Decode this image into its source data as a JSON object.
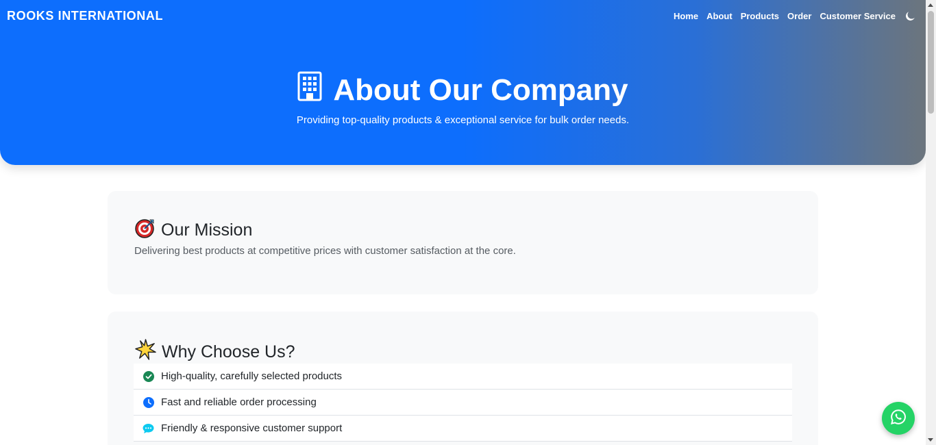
{
  "navbar": {
    "brand": "ROOKS INTERNATIONAL",
    "links": [
      "Home",
      "About",
      "Products",
      "Order",
      "Customer Service"
    ],
    "theme_icon": "moon-icon"
  },
  "hero": {
    "icon": "building-icon",
    "title": "About Our Company",
    "subtitle": "Providing top-quality products & exceptional service for bulk order needs."
  },
  "mission": {
    "icon": "target-icon",
    "title": "Our Mission",
    "text": "Delivering best products at competitive prices with customer satisfaction at the core."
  },
  "why": {
    "icon": "sparkle-icon",
    "title": "Why Choose Us?",
    "items": [
      {
        "icon": "check-circle-icon",
        "color": "#198754",
        "label": "High-quality, carefully selected products"
      },
      {
        "icon": "clock-icon",
        "color": "#0d6efd",
        "label": "Fast and reliable order processing"
      },
      {
        "icon": "chat-icon",
        "color": "#0dcaf0",
        "label": "Friendly & responsive customer support"
      }
    ]
  },
  "colors": {
    "primary": "#0d6efd",
    "gradient_end": "#6c757d",
    "whatsapp": "#25d366"
  },
  "floating": {
    "icon": "whatsapp-icon"
  }
}
